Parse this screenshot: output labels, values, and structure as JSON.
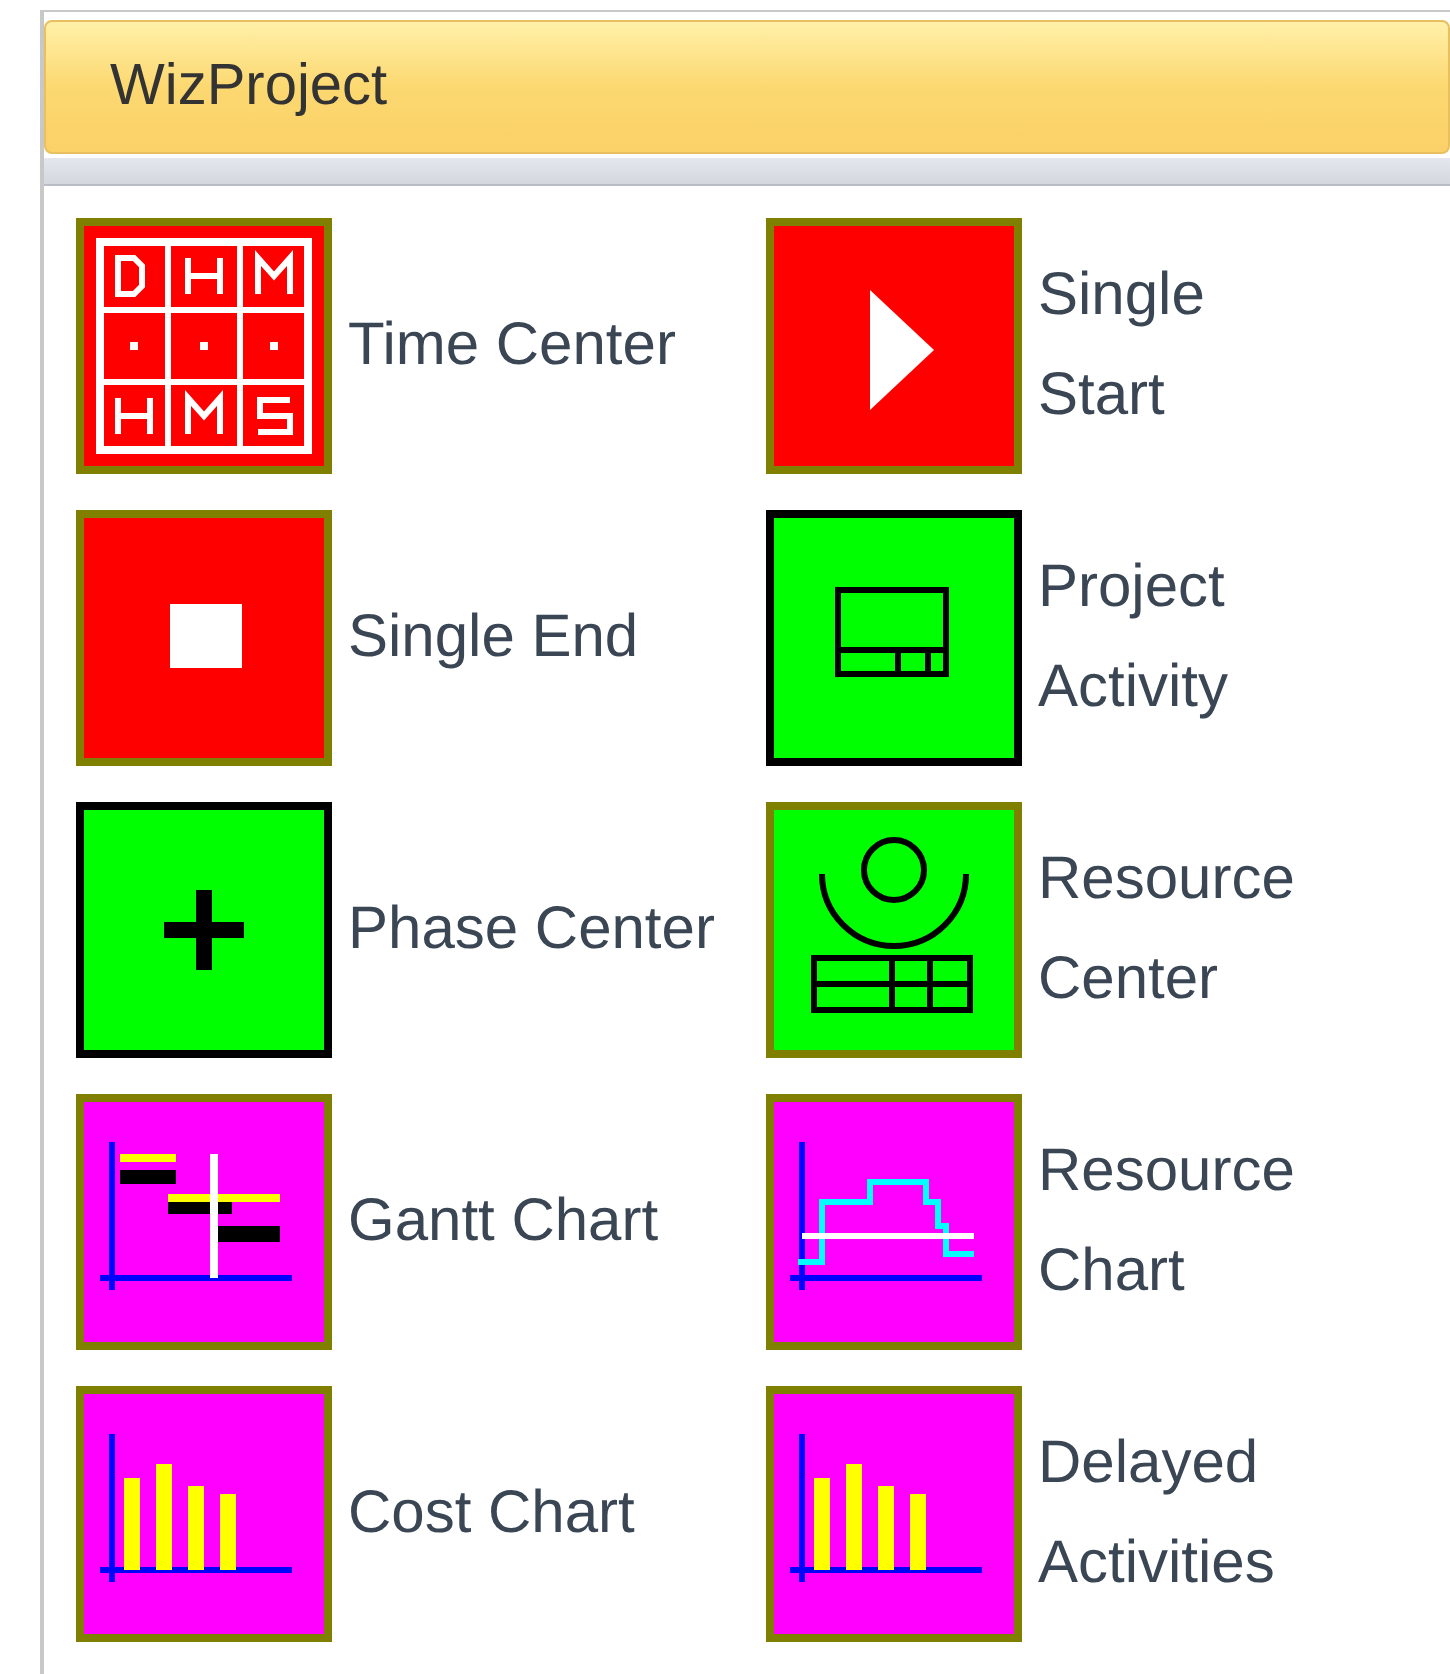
{
  "window": {
    "title": "WizProject"
  },
  "items": [
    {
      "label": "Time Center",
      "kind": "time",
      "color": "#ff0000",
      "framed": false
    },
    {
      "label": "Single Start",
      "kind": "start",
      "color": "#ff0000",
      "framed": false
    },
    {
      "label": "Single End",
      "kind": "end",
      "color": "#ff0000",
      "framed": false
    },
    {
      "label": "Project Activity",
      "kind": "activity",
      "color": "#00ff00",
      "framed": true
    },
    {
      "label": "Phase Center",
      "kind": "phase",
      "color": "#00ff00",
      "framed": true
    },
    {
      "label": "Resource Center",
      "kind": "resource",
      "color": "#00ff00",
      "framed": false
    },
    {
      "label": "Gantt Chart",
      "kind": "gantt",
      "color": "#ff00ff",
      "framed": false
    },
    {
      "label": "Resource Chart",
      "kind": "rchart",
      "color": "#ff00ff",
      "framed": false
    },
    {
      "label": "Cost Chart",
      "kind": "bars",
      "color": "#ff00ff",
      "framed": false
    },
    {
      "label": "Delayed Activities",
      "kind": "bars",
      "color": "#ff00ff",
      "framed": false
    }
  ]
}
